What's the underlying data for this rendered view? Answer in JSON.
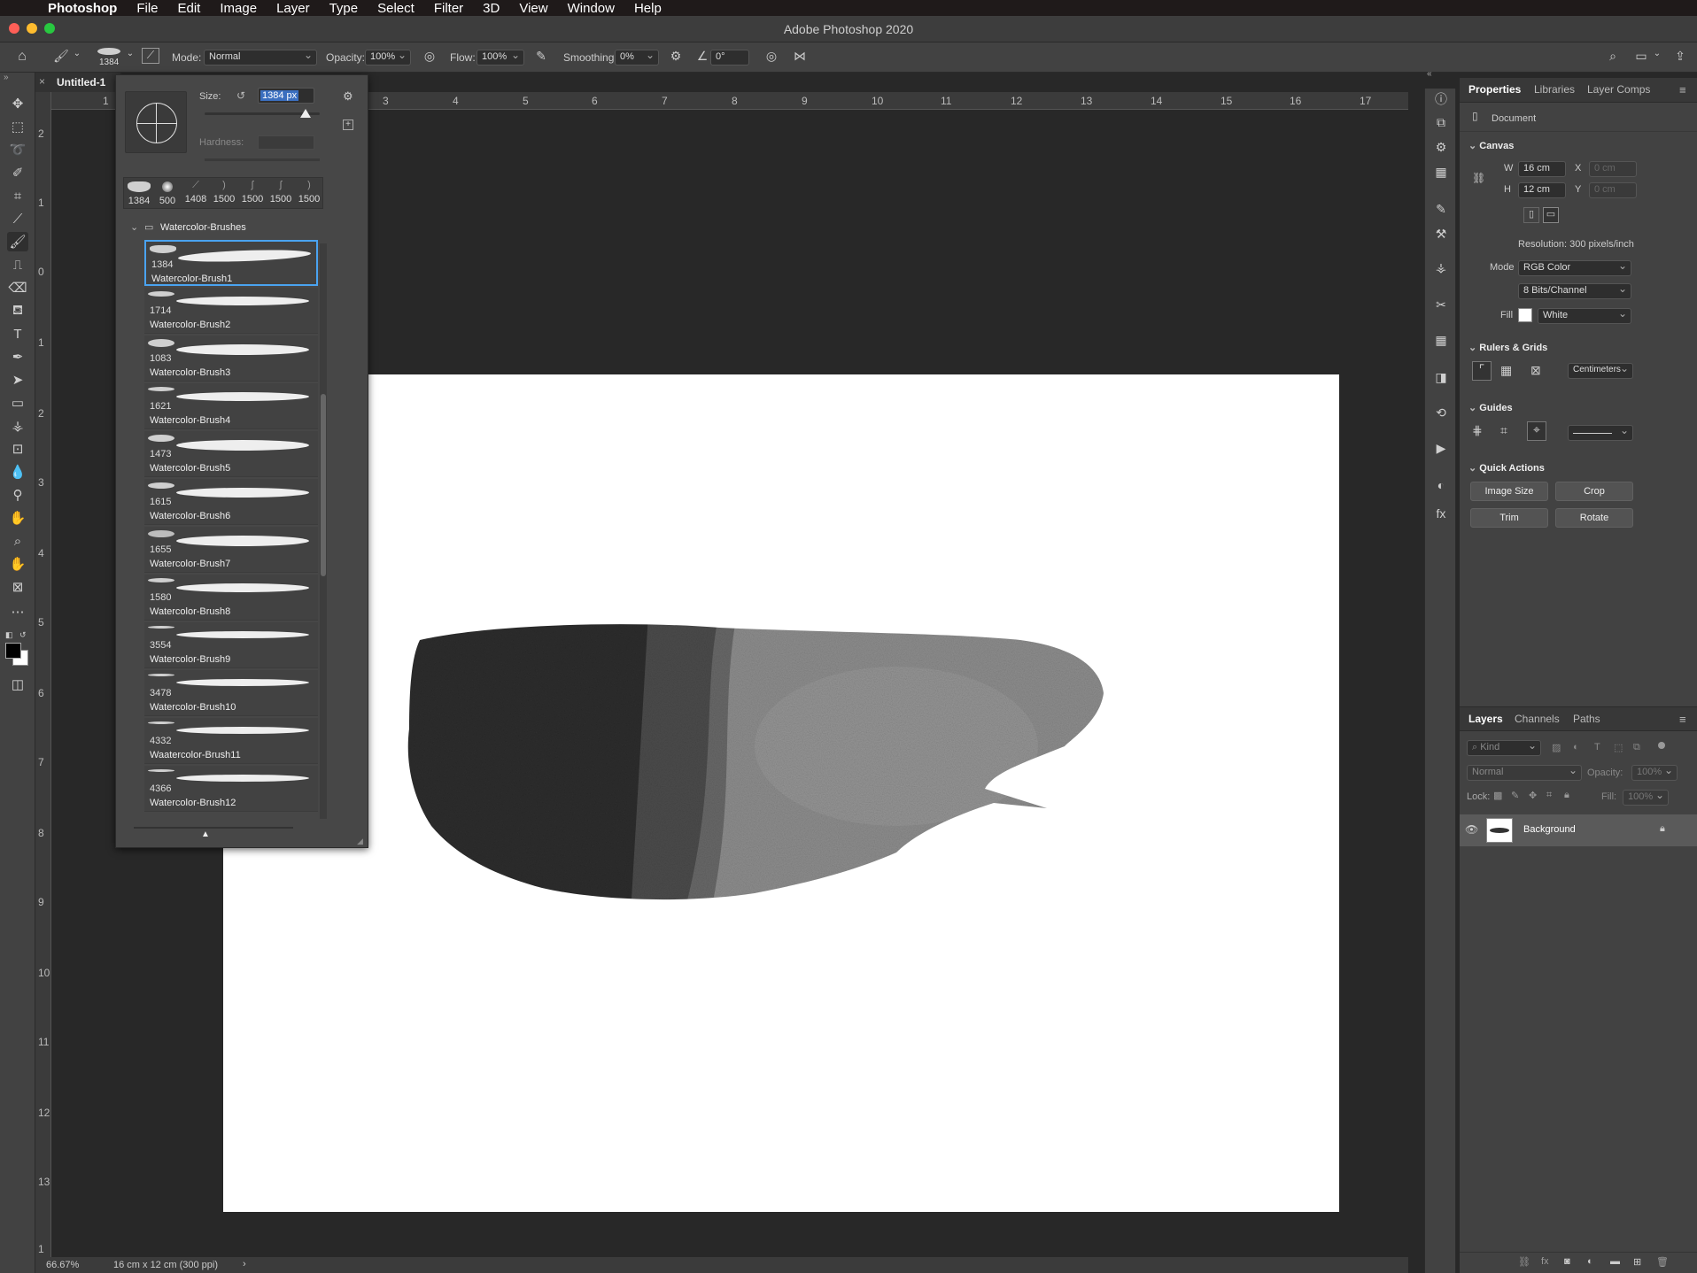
{
  "menubar": {
    "apple": "",
    "app": "Photoshop",
    "items": [
      "File",
      "Edit",
      "Image",
      "Layer",
      "Type",
      "Select",
      "Filter",
      "3D",
      "View",
      "Window",
      "Help"
    ]
  },
  "window": {
    "title": "Adobe Photoshop 2020"
  },
  "options": {
    "brush_size": "1384",
    "mode_label": "Mode:",
    "mode_value": "Normal",
    "opacity_label": "Opacity:",
    "opacity_value": "100%",
    "flow_label": "Flow:",
    "flow_value": "100%",
    "smoothing_label": "Smoothing:",
    "smoothing_value": "0%",
    "angle_value": "0°"
  },
  "document": {
    "tab": "Untitled-1",
    "ruler_top": [
      "1",
      "3",
      "4",
      "5",
      "6",
      "7",
      "8",
      "9",
      "10",
      "11",
      "12",
      "13",
      "14",
      "15",
      "16",
      "17"
    ],
    "ruler_left": [
      "2",
      "1",
      "0",
      "1",
      "2",
      "3",
      "4",
      "5",
      "6",
      "7",
      "8",
      "9",
      "10",
      "11",
      "12",
      "13",
      "1"
    ]
  },
  "status": {
    "zoom": "66.67%",
    "info": "16 cm x 12 cm (300 ppi)",
    "arrow": "›"
  },
  "brush_picker": {
    "size_label": "Size:",
    "size_value": "1384 px",
    "hardness_label": "Hardness:",
    "recent": [
      "1384",
      "500",
      "1408",
      "1500",
      "1500",
      "1500",
      "1500"
    ],
    "folder": "Watercolor-Brushes",
    "brushes": [
      {
        "num": "1384",
        "name": "Watercolor-Brush1"
      },
      {
        "num": "1714",
        "name": "Watercolor-Brush2"
      },
      {
        "num": "1083",
        "name": "Watercolor-Brush3"
      },
      {
        "num": "1621",
        "name": "Watercolor-Brush4"
      },
      {
        "num": "1473",
        "name": "Watercolor-Brush5"
      },
      {
        "num": "1615",
        "name": "Watercolor-Brush6"
      },
      {
        "num": "1655",
        "name": "Watercolor-Brush7"
      },
      {
        "num": "1580",
        "name": "Watercolor-Brush8"
      },
      {
        "num": "3554",
        "name": "Watercolor-Brush9"
      },
      {
        "num": "3478",
        "name": "Watercolor-Brush10"
      },
      {
        "num": "4332",
        "name": "Waatercolor-Brush11"
      },
      {
        "num": "4366",
        "name": "Watercolor-Brush12"
      }
    ]
  },
  "properties": {
    "tabs": [
      "Properties",
      "Libraries",
      "Layer Comps"
    ],
    "doc_label": "Document",
    "canvas": {
      "title": "Canvas",
      "w_label": "W",
      "w": "16 cm",
      "h_label": "H",
      "h": "12 cm",
      "x_label": "X",
      "x": "0 cm",
      "y_label": "Y",
      "y": "0 cm",
      "resolution": "Resolution: 300 pixels/inch",
      "mode_label": "Mode",
      "mode": "RGB Color",
      "depth": "8 Bits/Channel",
      "fill_label": "Fill",
      "fill": "White"
    },
    "rulers_title": "Rulers & Grids",
    "units": "Centimeters",
    "guides_title": "Guides",
    "quick_title": "Quick Actions",
    "quick": [
      "Image Size",
      "Crop",
      "Trim",
      "Rotate"
    ]
  },
  "layers": {
    "tabs": [
      "Layers",
      "Channels",
      "Paths"
    ],
    "kind": "Kind",
    "blend": "Normal",
    "opacity_label": "Opacity:",
    "opacity": "100%",
    "lock_label": "Lock:",
    "fill_label": "Fill:",
    "fill": "100%",
    "layer_name": "Background"
  }
}
